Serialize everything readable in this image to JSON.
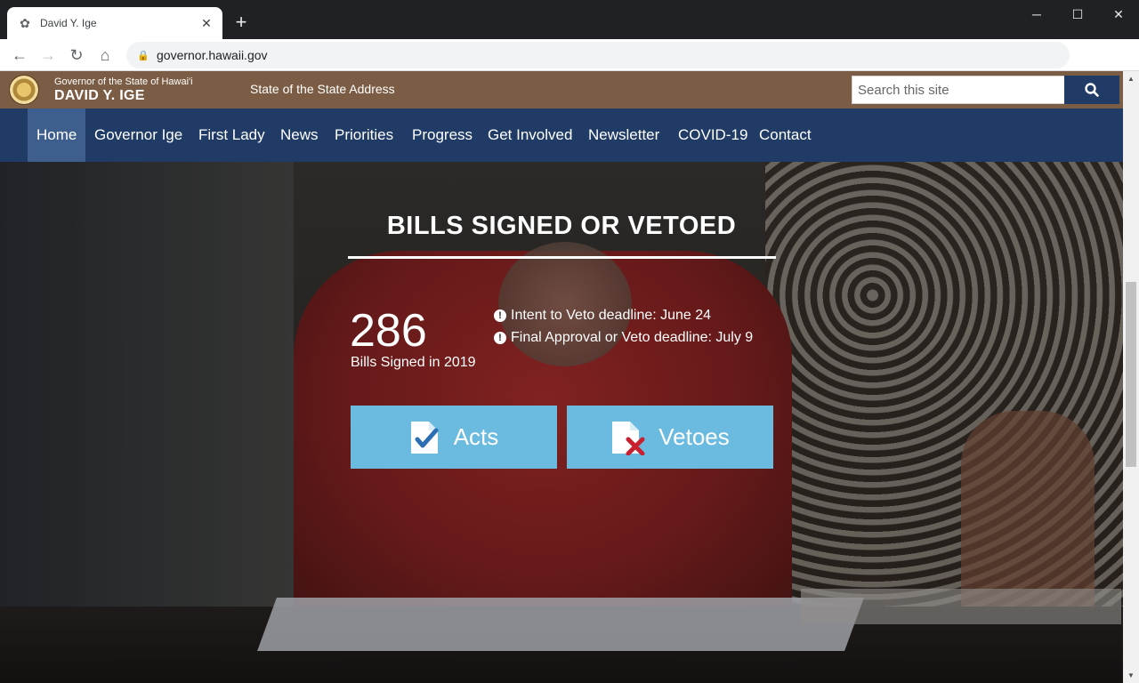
{
  "browser": {
    "tab_title": "David Y. Ige",
    "url": "governor.hawaii.gov",
    "new_tab": "+",
    "icons": {
      "favicon": "hibiscus-icon",
      "lock": "lock-icon"
    }
  },
  "header": {
    "subtitle": "Governor of the State of Hawai'i",
    "name": "DAVID Y. IGE",
    "link": "State of the State Address",
    "search_placeholder": "Search this site",
    "colors": {
      "topbar": "#7b5c44",
      "nav": "#1f3b66",
      "nav_active": "#3e5f8e"
    }
  },
  "nav": {
    "items": [
      {
        "label": "Home",
        "active": true
      },
      {
        "label": "Governor Ige"
      },
      {
        "label": "First Lady"
      },
      {
        "label": "News"
      },
      {
        "label": "Priorities"
      },
      {
        "label": "Progress"
      },
      {
        "label": "Get Involved"
      },
      {
        "label": "Newsletter"
      },
      {
        "label": "COVID-19"
      },
      {
        "label": "Contact"
      }
    ]
  },
  "hero": {
    "title": "BILLS SIGNED OR VETOED",
    "count": "286",
    "count_label": "Bills Signed in 2019",
    "deadlines": [
      "Intent to Veto deadline: June 24",
      "Final Approval or Veto deadline: July 9"
    ],
    "buttons": {
      "acts": "Acts",
      "vetoes": "Vetoes",
      "color": "#6bbadf"
    }
  }
}
